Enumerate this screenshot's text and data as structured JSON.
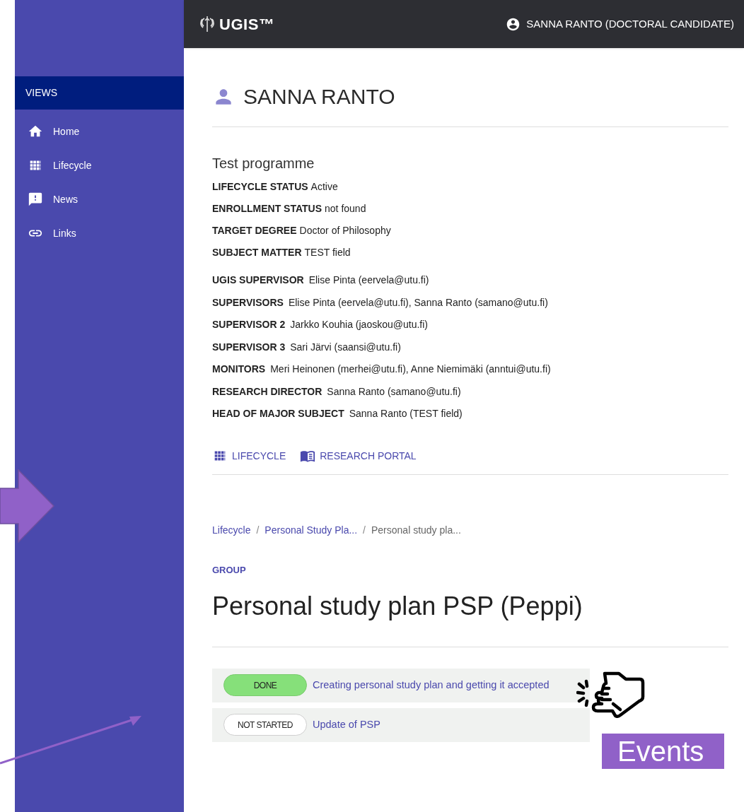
{
  "topbar": {
    "logo": "UGIS™",
    "user": "SANNA RANTO (DOCTORAL CANDIDATE)"
  },
  "sidebar": {
    "header": "VIEWS",
    "items": [
      {
        "label": "Home",
        "kind": "home"
      },
      {
        "label": "Lifecycle",
        "kind": "grid"
      },
      {
        "label": "News",
        "kind": "news"
      },
      {
        "label": "Links",
        "kind": "link"
      }
    ]
  },
  "profile": {
    "name": "SANNA RANTO",
    "programme": "Test programme",
    "status_fields": [
      {
        "label": "LIFECYCLE STATUS",
        "value": "Active"
      },
      {
        "label": "ENROLLMENT STATUS",
        "value": "not found"
      },
      {
        "label": "TARGET DEGREE",
        "value": "Doctor of Philosophy"
      },
      {
        "label": "SUBJECT MATTER",
        "value": "TEST field"
      }
    ],
    "people_fields": [
      {
        "label": "UGIS SUPERVISOR",
        "value": "Elise Pinta (eervela@utu.fi)"
      },
      {
        "label": "SUPERVISORS",
        "value": "Elise Pinta (eervela@utu.fi), Sanna Ranto (samano@utu.fi)"
      },
      {
        "label": "SUPERVISOR 2",
        "value": "Jarkko Kouhia (jaoskou@utu.fi)"
      },
      {
        "label": "SUPERVISOR 3",
        "value": "Sari Järvi (saansi@utu.fi)"
      },
      {
        "label": "MONITORS",
        "value": "Meri Heinonen (merhei@utu.fi), Anne Niemimäki (anntui@utu.fi)"
      },
      {
        "label": "RESEARCH DIRECTOR",
        "value": "Sanna Ranto (samano@utu.fi)"
      },
      {
        "label": "HEAD OF MAJOR SUBJECT",
        "value": "Sanna Ranto (TEST field)"
      }
    ],
    "links": [
      {
        "label": "LIFECYCLE",
        "kind": "grid"
      },
      {
        "label": "RESEARCH PORTAL",
        "kind": "book"
      }
    ]
  },
  "breadcrumb": [
    {
      "label": "Lifecycle",
      "kind": "link"
    },
    {
      "separator": "/",
      "kind": "separator"
    },
    {
      "label": "Personal Study Pla...",
      "kind": "link"
    },
    {
      "separator": "/",
      "kind": "separator"
    },
    {
      "label": "Personal study pla...",
      "kind": "current"
    }
  ],
  "group": {
    "label": "GROUP",
    "title": "Personal study plan PSP (Peppi)"
  },
  "events": [
    {
      "status": "DONE",
      "kind": "done",
      "title": "Creating personal study plan and getting it accepted"
    },
    {
      "status": "NOT STARTED",
      "kind": "not_started",
      "title": "Update of PSP"
    }
  ],
  "annotation": {
    "label": "Events"
  }
}
